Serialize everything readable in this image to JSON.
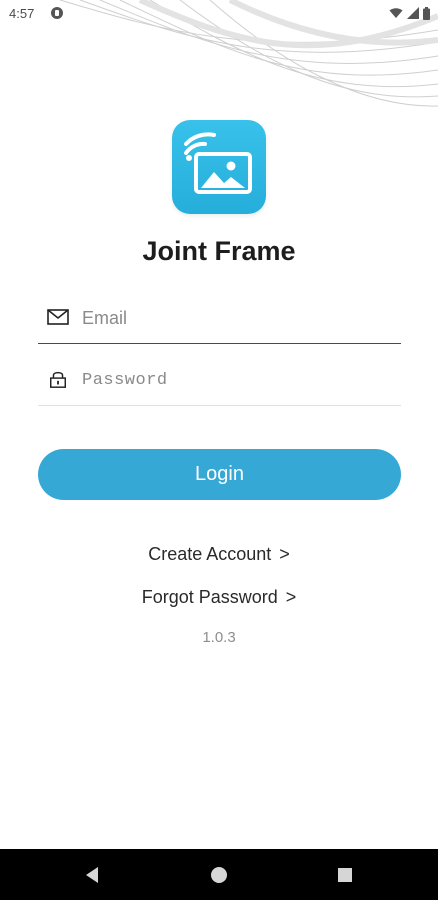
{
  "status_bar": {
    "time": "4:57",
    "icons": [
      "app-notification-icon",
      "wifi-icon",
      "signal-icon",
      "battery-icon"
    ]
  },
  "app": {
    "logo_icon": "wifi-photo-frame-icon",
    "title": "Joint Frame",
    "accent_color": "#35a8d6"
  },
  "form": {
    "email": {
      "icon": "mail-icon",
      "placeholder": "Email",
      "value": ""
    },
    "password": {
      "icon": "lock-icon",
      "placeholder": "Password",
      "value": ""
    },
    "login_label": "Login"
  },
  "links": {
    "create_account": "Create Account",
    "forgot_password": "Forgot Password",
    "chevron": ">"
  },
  "version": "1.0.3",
  "nav_bar": {
    "buttons": [
      "back-icon",
      "home-icon",
      "recents-icon"
    ]
  }
}
